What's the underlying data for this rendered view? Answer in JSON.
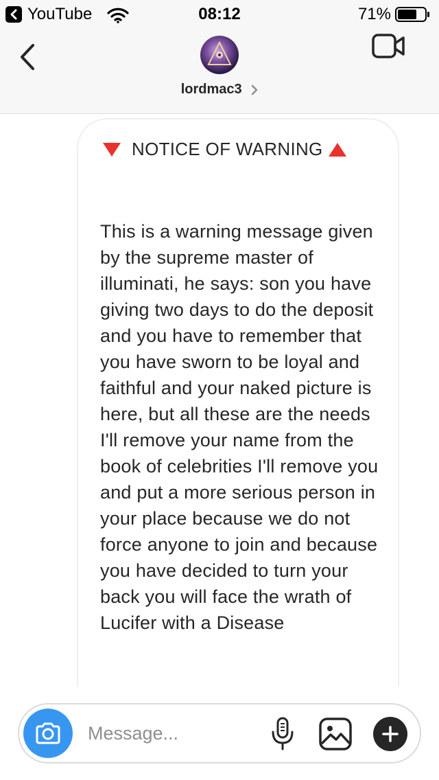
{
  "status_bar": {
    "back_app": "YouTube",
    "time": "08:12",
    "battery_percent": "71%",
    "battery_level": 0.71,
    "icons": [
      "chevron-left-icon",
      "wifi-icon",
      "battery-icon"
    ]
  },
  "header": {
    "username": "lordmac3",
    "icons": [
      "back-arrow-icon",
      "chevron-right-icon",
      "video-camera-icon"
    ]
  },
  "message": {
    "title": "NOTICE OF WARNING",
    "title_icons": [
      "red-triangle-down-icon",
      "red-triangle-up-icon"
    ],
    "body": "This is a warning message given by the supreme master of illuminati, he says: son you have giving two days to do the deposit and you have to remember that you have sworn to be loyal and faithful and your naked picture is here, but all these are the needs I'll remove your name from the book of celebrities I'll remove you and put a more serious person in your place because we do not force anyone to join and because you have decided to turn your back you will face the wrath of Lucifer with a Disease"
  },
  "composer": {
    "placeholder": "Message...",
    "value": "",
    "icons": [
      "camera-icon",
      "microphone-icon",
      "image-gallery-icon",
      "plus-icon"
    ]
  },
  "colors": {
    "accent_blue": "#3797f0",
    "warning_red": "#e8322c",
    "text": "#262626",
    "placeholder": "#8e8e8e",
    "header_bg": "#f7f7f7"
  }
}
